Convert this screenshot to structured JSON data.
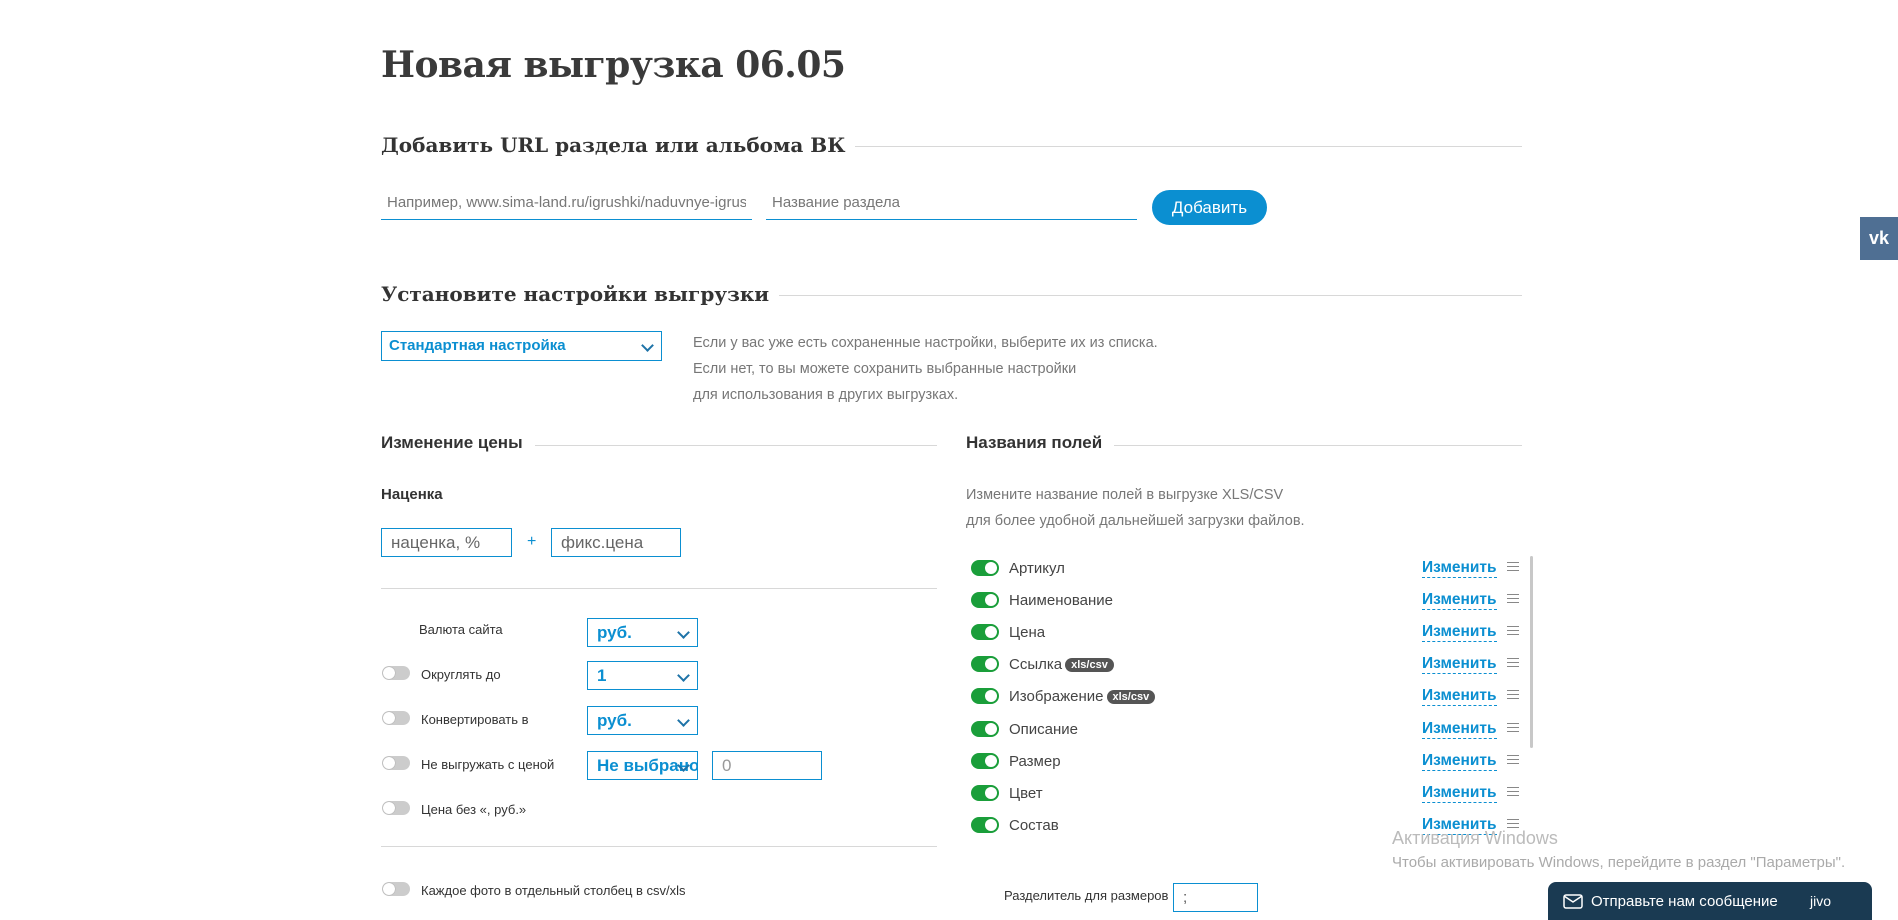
{
  "page": {
    "title": "Новая выгрузка 06.05"
  },
  "add_url": {
    "section_title": "Добавить URL раздела или альбома ВК",
    "url_placeholder": "Например, www.sima-land.ru/igrushki/naduvnye-igrushki",
    "name_placeholder": "Название раздела",
    "add_label": "Добавить"
  },
  "vk_tab": {
    "label": "vk",
    "icon": "vk-icon",
    "color": "#4f6f93"
  },
  "settings": {
    "section_title": "Установите настройки выгрузки",
    "preset_value": "Стандартная настройка",
    "hint_lines": [
      "Если у вас уже есть сохраненные настройки, выберите их из списка.",
      "Если нет, то вы можете сохранить выбранные настройки",
      "для использования в других выгрузках."
    ]
  },
  "price": {
    "title": "Изменение цены",
    "markup_label": "Наценка",
    "percent_placeholder": "наценка, %",
    "plus": "+",
    "fixed_placeholder": "фикс.цена",
    "site_currency_label": "Валюта сайта",
    "site_currency_value": "руб.",
    "round_label": "Округлять до",
    "round_value": "1",
    "convert_label": "Конвертировать в",
    "convert_value": "руб.",
    "skip_label": "Не выгружать с ценой",
    "skip_value": "Не выбрано",
    "skip_amount": "0",
    "no_currency_label": "Цена без «, руб.»",
    "photo_columns_label": "Каждое фото в отдельный столбец в csv/xls"
  },
  "fields": {
    "title": "Названия полей",
    "hint_lines": [
      "Измените название полей в выгрузке XLS/CSV",
      "для более удобной дальнейшей загрузки файлов."
    ],
    "change_label": "Изменить",
    "items": [
      {
        "label": "Артикул",
        "badge": "",
        "enabled": true
      },
      {
        "label": "Наименование",
        "badge": "",
        "enabled": true
      },
      {
        "label": "Цена",
        "badge": "",
        "enabled": true
      },
      {
        "label": "Ссылка",
        "badge": "xls/csv",
        "enabled": true
      },
      {
        "label": "Изображение",
        "badge": "xls/csv",
        "enabled": true
      },
      {
        "label": "Описание",
        "badge": "",
        "enabled": true
      },
      {
        "label": "Размер",
        "badge": "",
        "enabled": true
      },
      {
        "label": "Цвет",
        "badge": "",
        "enabled": true
      },
      {
        "label": "Состав",
        "badge": "",
        "enabled": true
      }
    ],
    "size_separator_label": "Разделитель для размеров",
    "size_separator_value": ";"
  },
  "windows_watermark": {
    "title": "Активация Windows",
    "subtitle": "Чтобы активировать Windows, перейдите в раздел \"Параметры\"."
  },
  "chat": {
    "label": "Отправьте нам сообщение",
    "brand": "jivo"
  },
  "colors": {
    "accent": "#0b8fd1",
    "toggle_on": "#1a9e3a",
    "badge": "#555555"
  }
}
